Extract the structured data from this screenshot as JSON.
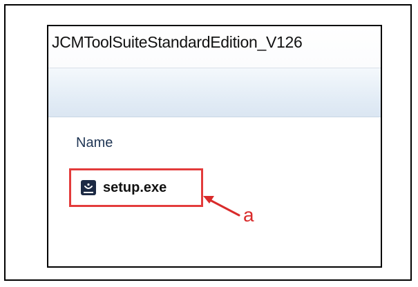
{
  "window": {
    "title": "JCMToolSuiteStandardEdition_V126"
  },
  "file_list": {
    "column_header": "Name",
    "files": [
      {
        "name": "setup.exe",
        "icon": "installer-icon"
      }
    ]
  },
  "annotation": {
    "label": "a"
  },
  "colors": {
    "highlight_border": "#e33b3b",
    "callout": "#d92b2b",
    "toolbar_gradient_top": "#f4f8fc",
    "toolbar_gradient_bottom": "#dbe6f2"
  }
}
